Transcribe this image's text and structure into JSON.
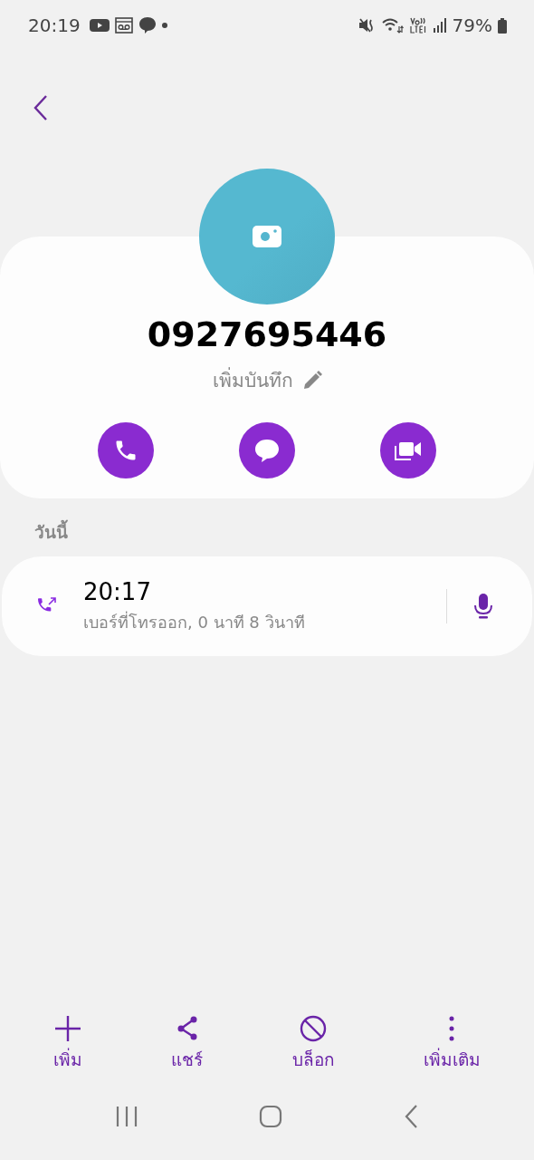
{
  "status_bar": {
    "time": "20:19",
    "battery": "79%"
  },
  "contact": {
    "number": "0927695446",
    "note": "เพิ่มบันทึก"
  },
  "quick_actions": [
    {
      "kind": "call"
    },
    {
      "kind": "message"
    },
    {
      "kind": "video"
    }
  ],
  "history": {
    "heading": "วันนี้",
    "calls": [
      {
        "time": "20:17",
        "detail": "เบอร์ที่โทรออก, 0 นาที 8 วินาที"
      }
    ]
  },
  "bottom_actions": [
    {
      "kind": "add",
      "label": "เพิ่ม"
    },
    {
      "kind": "share",
      "label": "แชร์"
    },
    {
      "kind": "block",
      "label": "บล็อก"
    },
    {
      "kind": "more",
      "label": "เพิ่มเติม"
    }
  ]
}
